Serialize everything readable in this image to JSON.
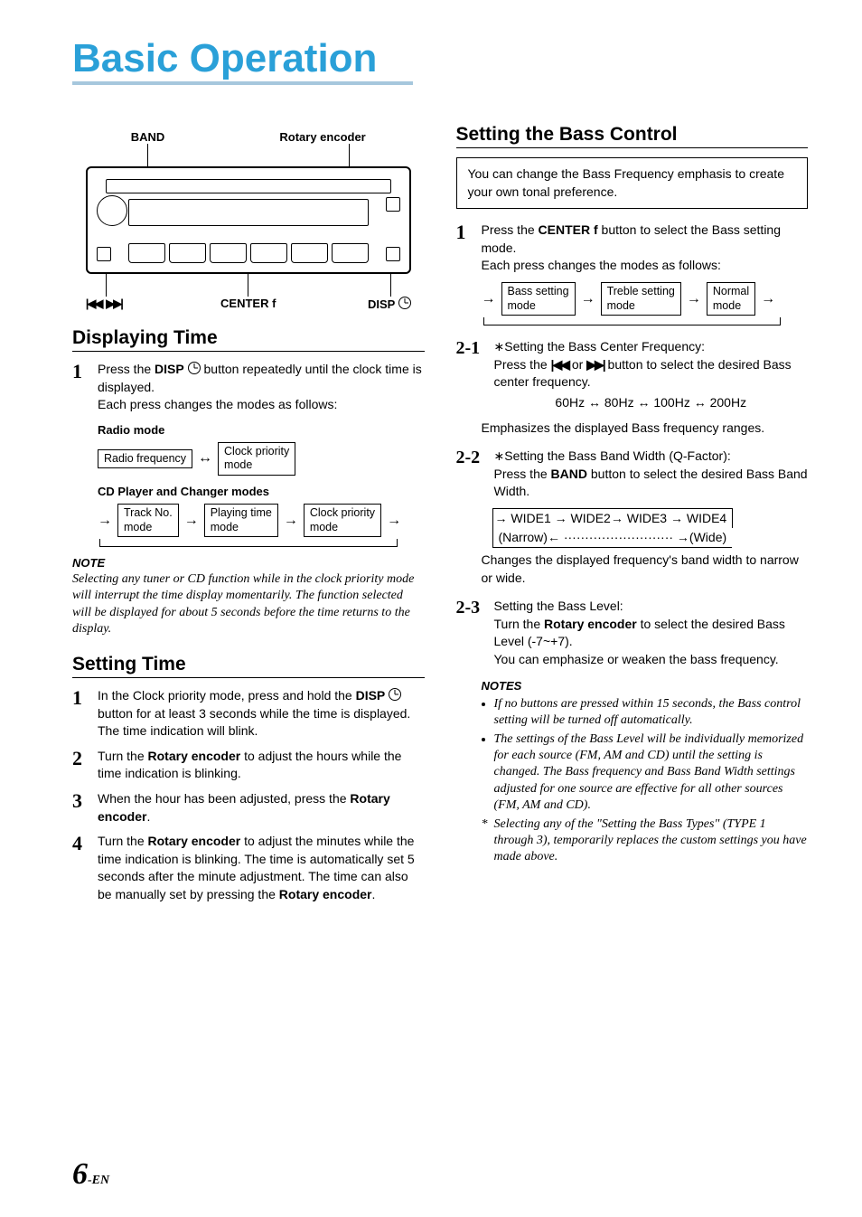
{
  "title": "Basic Operation",
  "device": {
    "top_left": "BAND",
    "top_right": "Rotary encoder",
    "bot_left": "⏮  ⏭",
    "bot_center": "CENTER f",
    "bot_right": "DISP"
  },
  "left": {
    "sectionA": "Displaying Time",
    "stepA1": "Press the ",
    "stepA1_btn": "DISP",
    "stepA1_cont": " button repeatedly until the clock time is displayed.",
    "stepA1_line2": "Each press changes the modes as follows:",
    "radio_mode_label": "Radio mode",
    "radio_box1": "Radio frequency",
    "radio_arrow": "↔",
    "radio_box2": "Clock priority\nmode",
    "cd_mode_label": "CD Player and Changer modes",
    "cd_box1": "Track No.\nmode",
    "cd_box2": "Playing time\nmode",
    "cd_box3": "Clock priority\nmode",
    "noteA_head": "NOTE",
    "noteA_body": "Selecting any tuner or CD function while in the clock priority mode will interrupt the time display momentarily. The function selected will be displayed for about 5 seconds before the time returns to the display.",
    "sectionB": "Setting Time",
    "stepB1a": "In the Clock priority mode, press and hold the ",
    "stepB1_btn": "DISP",
    "stepB1b": " button for at least 3 seconds while the time is displayed. The time indication will blink.",
    "stepB2a": "Turn the ",
    "stepB2_b": "Rotary encoder",
    "stepB2c": " to adjust the hours while the time indication is blinking.",
    "stepB3a": "When the hour has been adjusted, press the ",
    "stepB3_b": "Rotary encoder",
    "stepB3c": ".",
    "stepB4a": "Turn the ",
    "stepB4_b": "Rotary encoder",
    "stepB4c": " to adjust the minutes while the time indication is blinking. The time is automatically set 5 seconds after the minute adjustment. The time can also be manually set by pressing the ",
    "stepB4_d": "Rotary encoder",
    "stepB4e": "."
  },
  "right": {
    "sectionC": "Setting the Bass Control",
    "infobox": "You can change the Bass Frequency emphasis to create your own tonal preference.",
    "stepC1a": "Press the ",
    "stepC1_btn": "CENTER f",
    "stepC1b": " button to select the Bass setting mode.",
    "stepC1_line2": "Each press changes the modes as follows:",
    "c1_box1": "Bass setting\nmode",
    "c1_box2": "Treble setting\nmode",
    "c1_box3": "Normal\nmode",
    "stepC21_num": "2-1",
    "stepC21a": "∗Setting the Bass Center Frequency:",
    "stepC21b": "Press the ",
    "stepC21c": " or ",
    "stepC21d": " button to select the desired Bass center frequency.",
    "stepC21_freq": "60Hz ↔ 80Hz ↔ 100Hz ↔ 200Hz",
    "stepC21_e": "Emphasizes the displayed Bass frequency ranges.",
    "stepC22_num": "2-2",
    "stepC22a": "∗Setting the Bass Band Width (Q-Factor):",
    "stepC22b": "Press the ",
    "stepC22_btn": "BAND",
    "stepC22c": " button to select the desired Bass Band Width.",
    "stepC22_flow1": "→ WIDE1 → WIDE2→ WIDE3 → WIDE4",
    "stepC22_flow2": "(Narrow)← ·························· →(Wide)",
    "stepC22_d": "Changes the displayed frequency's band width to narrow or wide.",
    "stepC23_num": "2-3",
    "stepC23a": "Setting the Bass Level:",
    "stepC23b": "Turn the ",
    "stepC23_btn": "Rotary encoder",
    "stepC23c": " to select the desired Bass Level (-7~+7).",
    "stepC23d": "You can emphasize or weaken the bass frequency.",
    "notesC_head": "NOTES",
    "notesC_1": "If no buttons are pressed within 15 seconds, the Bass control setting will be turned off automatically.",
    "notesC_2": "The settings of the Bass Level will be individually memorized for each source (FM, AM and CD) until the setting is changed. The Bass frequency and Bass Band Width settings adjusted for one source are effective for all other sources (FM, AM and CD).",
    "notesC_3": "Selecting any of the \"Setting the Bass Types\" (TYPE 1 through 3), temporarily replaces the custom settings you have made above."
  },
  "page_num": "6",
  "page_suffix": "-EN"
}
